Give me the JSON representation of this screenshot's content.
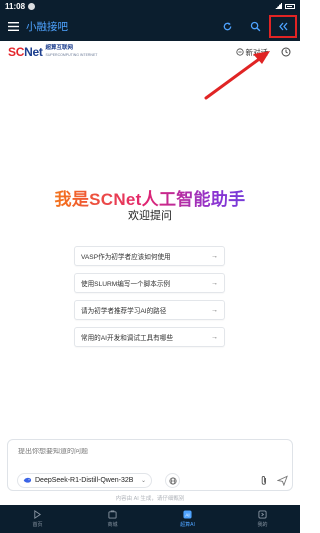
{
  "status_bar": {
    "time": "11:08"
  },
  "app_bar": {
    "title": "小融接吧",
    "icons": [
      "menu-icon",
      "refresh-icon",
      "search-icon",
      "double-chevron-left-icon"
    ]
  },
  "header": {
    "logo_brand_sc": "SC",
    "logo_brand_net": "Net",
    "logo_cn": "超算互联网",
    "logo_en": "SUPERCOMPUTING INTERNET",
    "new_chat_label": "新对话"
  },
  "hero": {
    "title": "我是SCNet人工智能助手",
    "subtitle": "欢迎提问"
  },
  "suggestions": [
    {
      "text": "VASP作为初学者应该如何使用"
    },
    {
      "text": "使用SLURM编写一个脚本示例"
    },
    {
      "text": "请为初学者推荐学习AI的路径"
    },
    {
      "text": "常用的AI开发和调试工具有哪些"
    }
  ],
  "input": {
    "placeholder": "提出你想要知道的问题",
    "model": "DeepSeek-R1-Distill-Qwen-32B"
  },
  "disclaimer": "内容由 AI 生成，请仔细甄别",
  "bottom_nav": [
    {
      "label": "首页",
      "icon": "home-icon"
    },
    {
      "label": "商城",
      "icon": "shop-icon"
    },
    {
      "label": "超算AI",
      "icon": "ai-icon"
    },
    {
      "label": "我的",
      "icon": "profile-icon"
    }
  ],
  "colors": {
    "bar_bg": "#0b1e2e",
    "accent_blue": "#4ea3ff",
    "highlight_red": "#e02424"
  }
}
